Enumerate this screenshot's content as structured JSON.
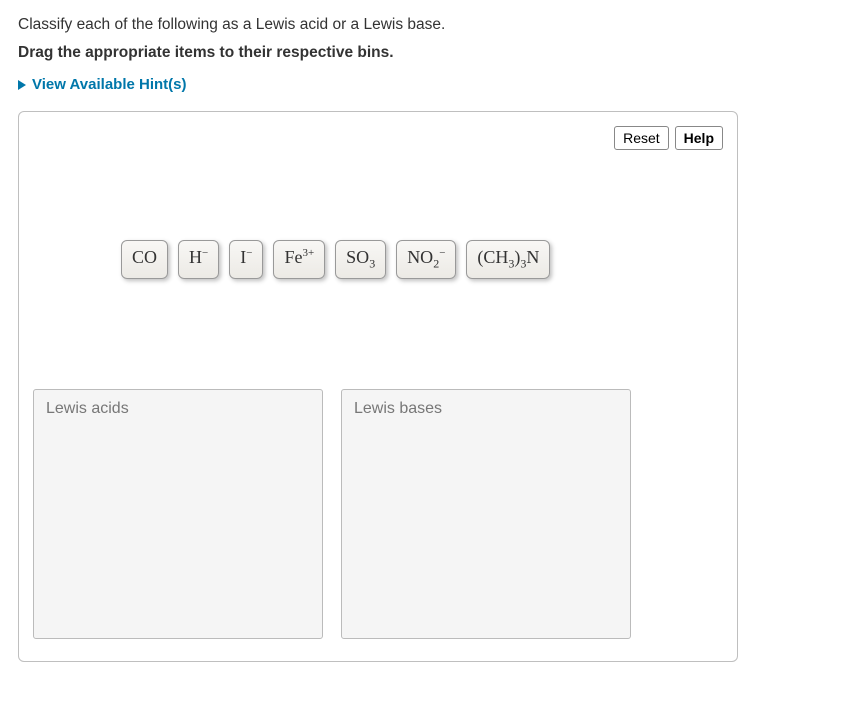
{
  "question": "Classify each of the following as a Lewis acid or a Lewis base.",
  "instruction": "Drag the appropriate items to their respective bins.",
  "hints_label": "View Available Hint(s)",
  "buttons": {
    "reset": "Reset",
    "help": "Help"
  },
  "items": [
    {
      "html": "CO"
    },
    {
      "html": "H<sup>−</sup>"
    },
    {
      "html": "I<sup>−</sup>"
    },
    {
      "html": "Fe<sup>3+</sup>"
    },
    {
      "html": "SO<sub>3</sub>"
    },
    {
      "html": "NO<sub>2</sub><sup>−</sup>"
    },
    {
      "html": "(CH<sub>3</sub>)<sub>3</sub>N"
    }
  ],
  "bins": {
    "acids": "Lewis acids",
    "bases": "Lewis bases"
  }
}
